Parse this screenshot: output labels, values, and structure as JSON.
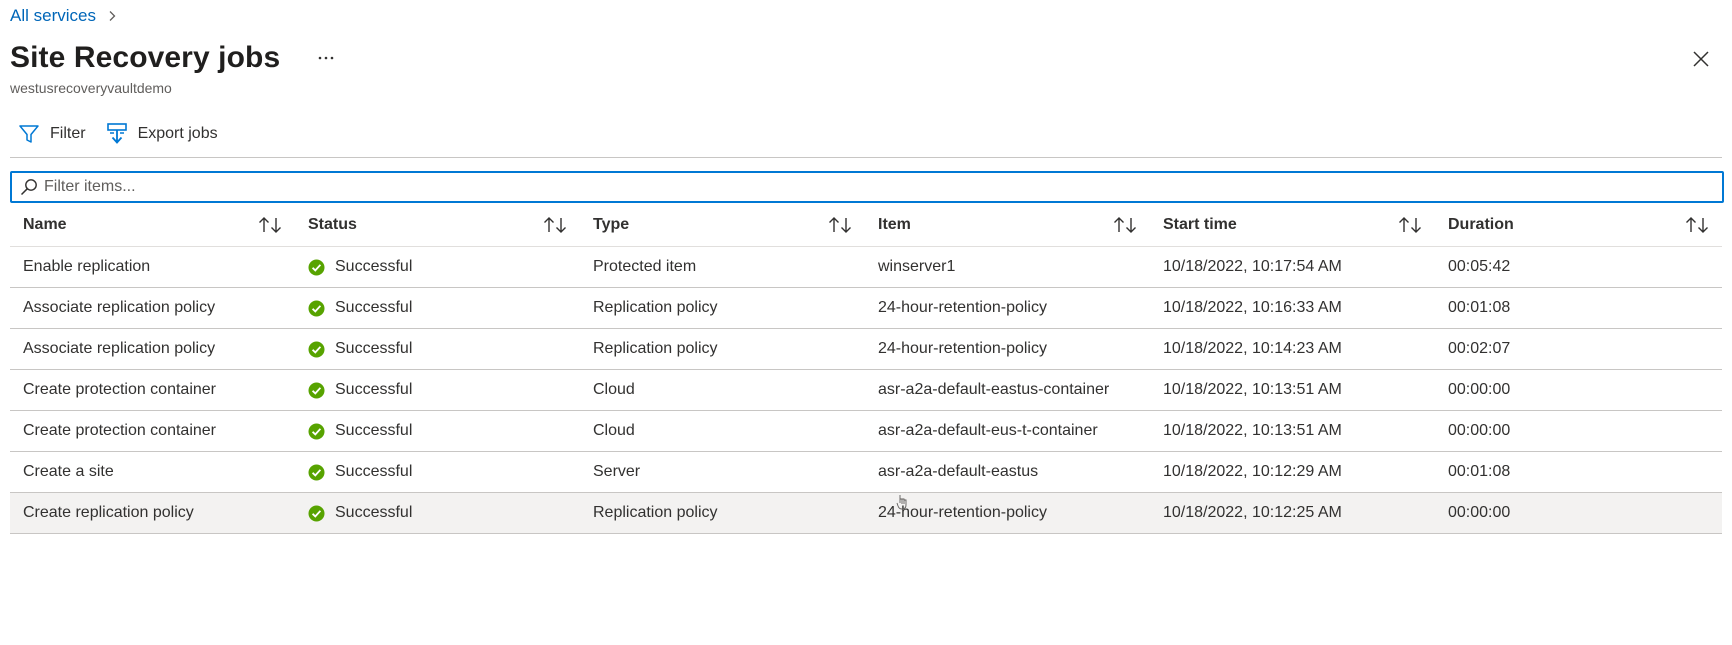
{
  "breadcrumb": {
    "link": "All services"
  },
  "header": {
    "title": "Site Recovery jobs",
    "more": "···",
    "subtitle": "westusrecoveryvaultdemo"
  },
  "toolbar": {
    "filter_label": "Filter",
    "export_label": "Export jobs"
  },
  "search": {
    "placeholder": "Filter items...",
    "value": ""
  },
  "colors": {
    "accent": "#0078d4",
    "link": "#0066b8",
    "success": "#57a300"
  },
  "table": {
    "columns": [
      "Name",
      "Status",
      "Type",
      "Item",
      "Start time",
      "Duration"
    ],
    "rows": [
      {
        "name": "Enable replication",
        "status": "Successful",
        "type": "Protected item",
        "item": "winserver1",
        "start": "10/18/2022, 10:17:54 AM",
        "duration": "00:05:42"
      },
      {
        "name": "Associate replication policy",
        "status": "Successful",
        "type": "Replication policy",
        "item": "24-hour-retention-policy",
        "start": "10/18/2022, 10:16:33 AM",
        "duration": "00:01:08"
      },
      {
        "name": "Associate replication policy",
        "status": "Successful",
        "type": "Replication policy",
        "item": "24-hour-retention-policy",
        "start": "10/18/2022, 10:14:23 AM",
        "duration": "00:02:07"
      },
      {
        "name": "Create protection container",
        "status": "Successful",
        "type": "Cloud",
        "item": "asr-a2a-default-eastus-container",
        "start": "10/18/2022, 10:13:51 AM",
        "duration": "00:00:00"
      },
      {
        "name": "Create protection container",
        "status": "Successful",
        "type": "Cloud",
        "item": "asr-a2a-default-eus-t-container",
        "start": "10/18/2022, 10:13:51 AM",
        "duration": "00:00:00"
      },
      {
        "name": "Create a site",
        "status": "Successful",
        "type": "Server",
        "item": "asr-a2a-default-eastus",
        "start": "10/18/2022, 10:12:29 AM",
        "duration": "00:01:08"
      },
      {
        "name": "Create replication policy",
        "status": "Successful",
        "type": "Replication policy",
        "item": "24-hour-retention-policy",
        "start": "10/18/2022, 10:12:25 AM",
        "duration": "00:00:00"
      }
    ]
  }
}
